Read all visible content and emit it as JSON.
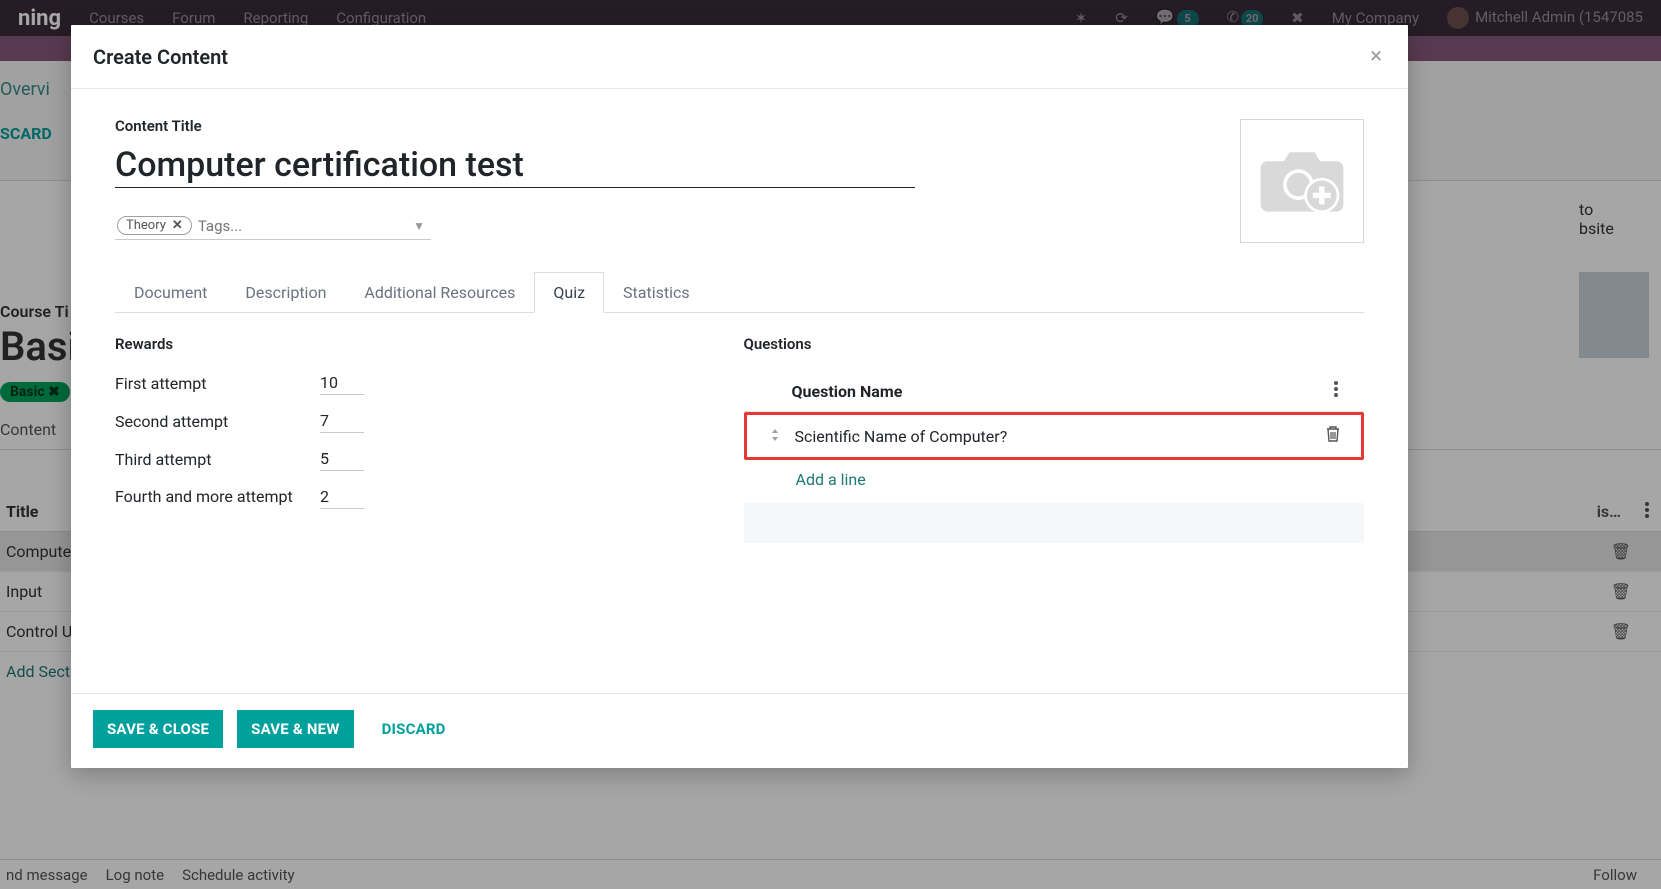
{
  "topbar": {
    "app_fragment": "ning",
    "menus": [
      "Courses",
      "Forum",
      "Reporting",
      "Configuration"
    ],
    "msg_count": "5",
    "activity_count": "20",
    "company": "My Company",
    "user": "Mitchell Admin (1547085"
  },
  "bg": {
    "overview": "Overvi",
    "discard": "SCARD",
    "go_to_label": "to",
    "go_to_label2": "bsite",
    "course_title_label": "Course Ti",
    "course_title": "Basi",
    "chip": "Basic ✖",
    "tab": "Content",
    "list_header_title": "Title",
    "list_header_right": "is…",
    "rows": [
      "Compute",
      "Input",
      "Control U"
    ],
    "add_section": "Add Sect",
    "footer": [
      "nd message",
      "Log note",
      "Schedule activity"
    ],
    "follow": "Follow"
  },
  "modal": {
    "title": "Create Content",
    "content_title_label": "Content Title",
    "content_title_value": "Computer certification test",
    "tag_chip": "Theory",
    "tag_placeholder": "Tags...",
    "tabs": [
      "Document",
      "Description",
      "Additional Resources",
      "Quiz",
      "Statistics"
    ],
    "active_tab_index": 3,
    "rewards_label": "Rewards",
    "rewards": [
      {
        "label": "First attempt",
        "value": "10"
      },
      {
        "label": "Second attempt",
        "value": "7"
      },
      {
        "label": "Third attempt",
        "value": "5"
      },
      {
        "label": "Fourth and more attempt",
        "value": "2"
      }
    ],
    "questions_label": "Questions",
    "question_header": "Question Name",
    "question_rows": [
      {
        "name": "Scientific Name of Computer?",
        "highlight": true
      }
    ],
    "add_line": "Add a line",
    "footer": {
      "save_close": "SAVE & CLOSE",
      "save_new": "SAVE & NEW",
      "discard": "DISCARD"
    }
  }
}
